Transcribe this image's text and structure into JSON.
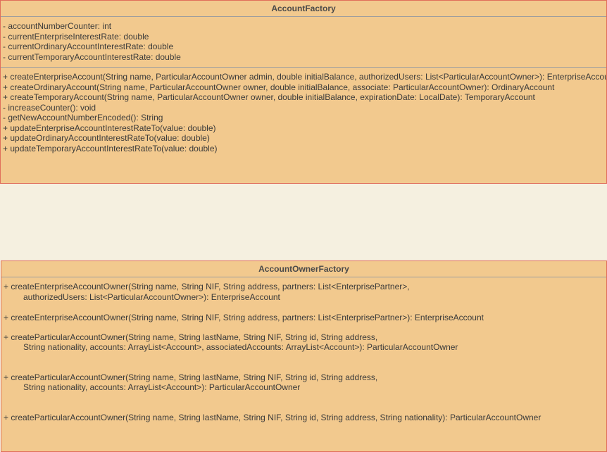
{
  "account_factory": {
    "name": "AccountFactory",
    "attributes": [
      "- accountNumberCounter: int",
      "- currentEnterpriseInterestRate: double",
      "- currentOrdinaryAccountInterestRate: double",
      "- currentTemporaryAccountInterestRate: double"
    ],
    "methods": [
      "+ createEnterpriseAccount(String name, ParticularAccountOwner admin, double initialBalance, authorizedUsers: List<ParticularAccountOwner>): EnterpriseAccount",
      "+ createOrdinaryAccount(String name, ParticularAccountOwner owner, double initialBalance, associate: ParticularAccountOwner): OrdinaryAccount",
      "+ createTemporaryAccount(String name, ParticularAccountOwner owner, double initialBalance, expirationDate: LocalDate): TemporaryAccount",
      "- increaseCounter(): void",
      "- getNewAccountNumberEncoded(): String",
      "+ updateEnterpriseAccountInterestRateTo(value: double)",
      "+ updateOrdinaryAccountInterestRateTo(value: double)",
      "+ updateTemporaryAccountInterestRateTo(value: double)"
    ]
  },
  "account_owner_factory": {
    "name": "AccountOwnerFactory",
    "methods": [
      {
        "line1": "+ createEnterpriseAccountOwner(String name, String NIF, String address, partners: List<EnterprisePartner>,",
        "line2": "authorizedUsers: List<ParticularAccountOwner>): EnterpriseAccount"
      },
      {
        "line1": "+ createEnterpriseAccountOwner(String name, String NIF, String address, partners: List<EnterprisePartner>): EnterpriseAccount",
        "line2": ""
      },
      {
        "line1": "+ createParticularAccountOwner(String name, String lastName, String NIF, String id, String address,",
        "line2": "String nationality, accounts: ArrayList<Account>, associatedAccounts: ArrayList<Account>): ParticularAccountOwner"
      },
      {
        "line1": "+ createParticularAccountOwner(String name, String lastName, String NIF, String id, String address,",
        "line2": "String nationality, accounts: ArrayList<Account>): ParticularAccountOwner"
      },
      {
        "line1": "+ createParticularAccountOwner(String name, String lastName, String NIF, String id, String address, String nationality): ParticularAccountOwner",
        "line2": ""
      }
    ]
  }
}
